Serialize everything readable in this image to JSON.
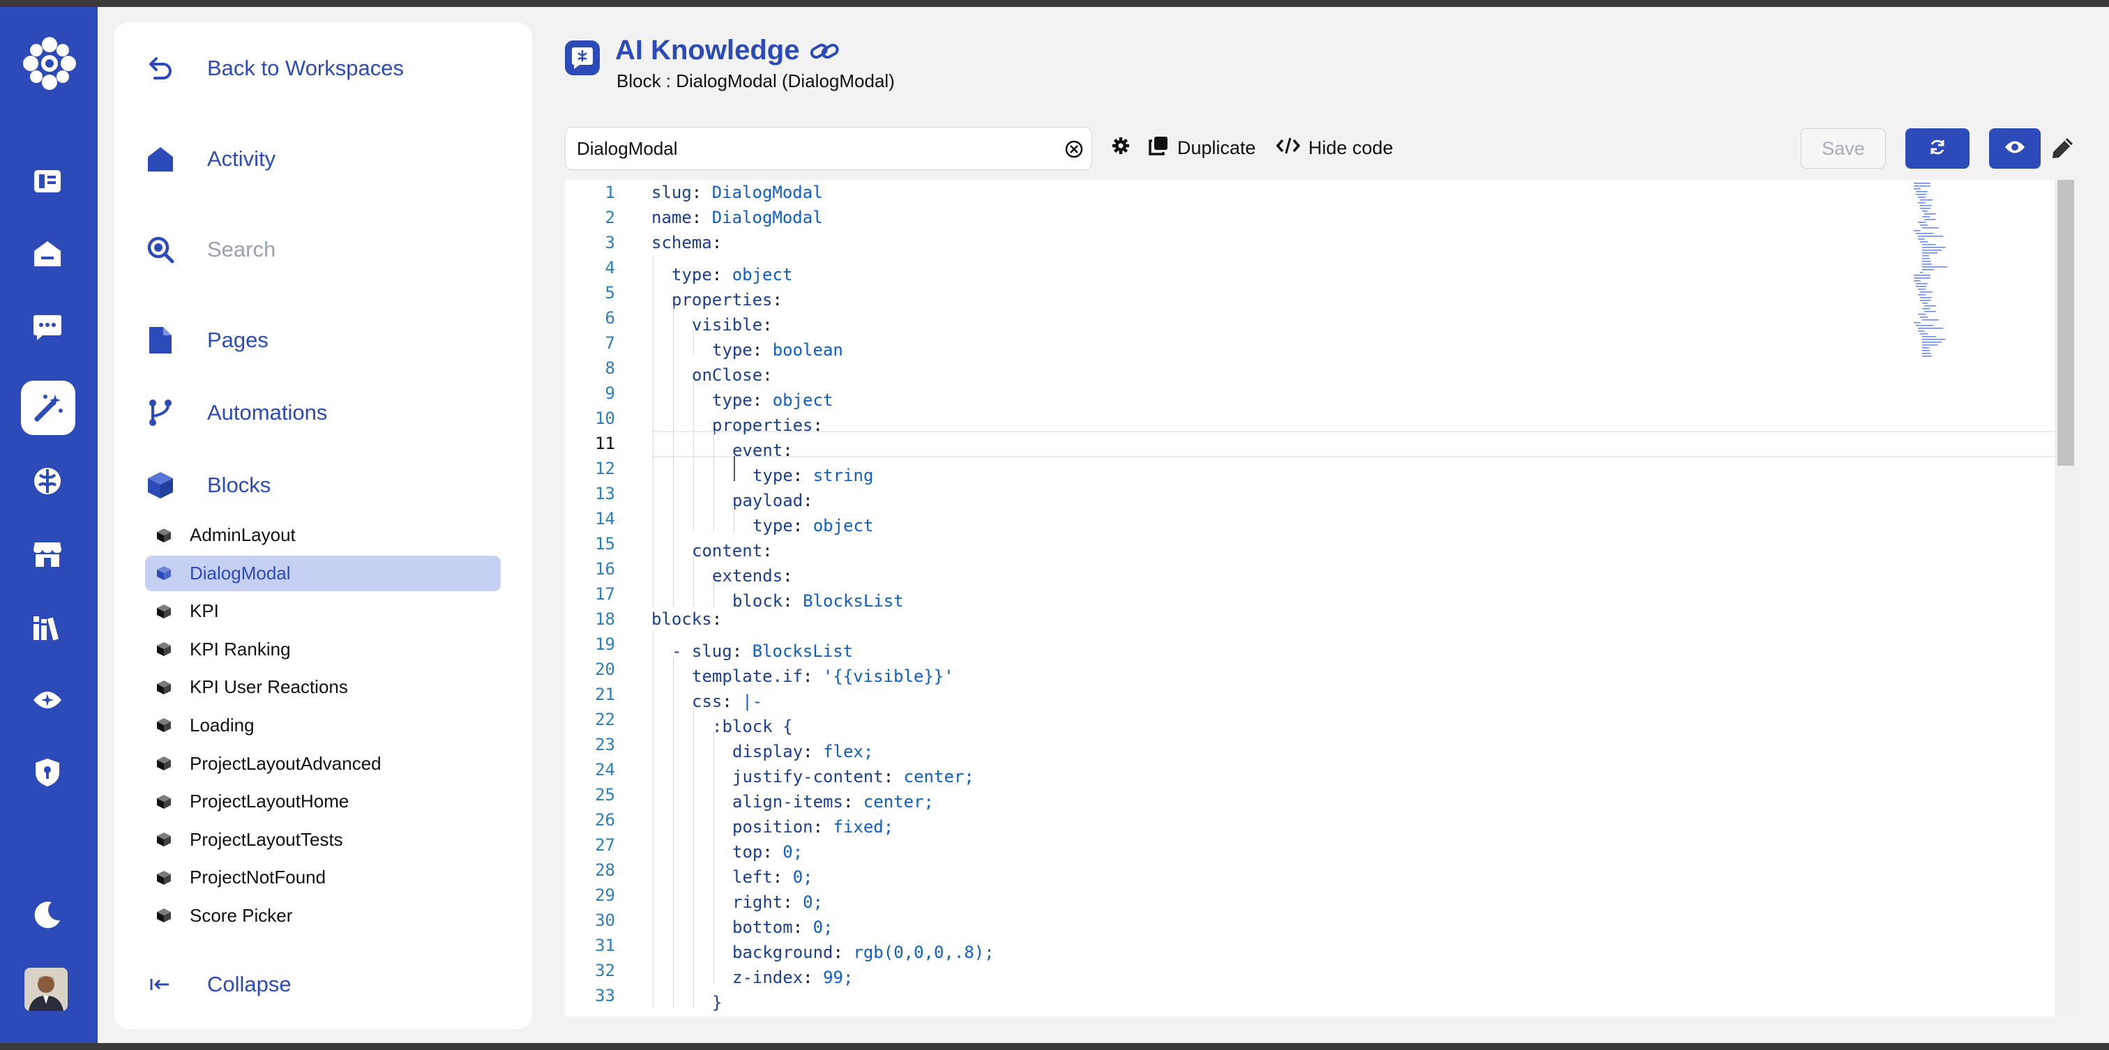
{
  "app": {
    "title": "AI Knowledge",
    "subtitle": "Block : DialogModal (DialogModal)"
  },
  "rail": {
    "icons": [
      "app-logo-icon",
      "dashboard-icon",
      "home-icon",
      "chat-icon",
      "magic-wand-icon",
      "brain-icon",
      "store-icon",
      "library-icon",
      "eye-icon",
      "shield-icon",
      "moon-icon",
      "user-avatar"
    ]
  },
  "nav": {
    "back": "Back to Workspaces",
    "activity": "Activity",
    "search": "Search",
    "pages": "Pages",
    "automations": "Automations",
    "blocks": "Blocks",
    "collapse": "Collapse",
    "block_items": [
      {
        "label": "AdminLayout",
        "active": false
      },
      {
        "label": "DialogModal",
        "active": true
      },
      {
        "label": "KPI",
        "active": false
      },
      {
        "label": "KPI Ranking",
        "active": false
      },
      {
        "label": "KPI User Reactions",
        "active": false
      },
      {
        "label": "Loading",
        "active": false
      },
      {
        "label": "ProjectLayoutAdvanced",
        "active": false
      },
      {
        "label": "ProjectLayoutHome",
        "active": false
      },
      {
        "label": "ProjectLayoutTests",
        "active": false
      },
      {
        "label": "ProjectNotFound",
        "active": false
      },
      {
        "label": "Score Picker",
        "active": false
      }
    ]
  },
  "toolbar": {
    "search_value": "DialogModal",
    "duplicate": "Duplicate",
    "hide_code": "Hide code",
    "save": "Save"
  },
  "editor": {
    "current_line": 11,
    "lines": [
      {
        "n": 1,
        "indent": 0,
        "key": "slug",
        "sep": ": ",
        "val": "DialogModal"
      },
      {
        "n": 2,
        "indent": 0,
        "key": "name",
        "sep": ": ",
        "val": "DialogModal"
      },
      {
        "n": 3,
        "indent": 0,
        "key": "schema",
        "sep": ":",
        "val": ""
      },
      {
        "n": 4,
        "indent": 1,
        "key": "type",
        "sep": ": ",
        "val": "object"
      },
      {
        "n": 5,
        "indent": 1,
        "key": "properties",
        "sep": ":",
        "val": ""
      },
      {
        "n": 6,
        "indent": 2,
        "key": "visible",
        "sep": ":",
        "val": ""
      },
      {
        "n": 7,
        "indent": 3,
        "key": "type",
        "sep": ": ",
        "val": "boolean"
      },
      {
        "n": 8,
        "indent": 2,
        "key": "onClose",
        "sep": ":",
        "val": ""
      },
      {
        "n": 9,
        "indent": 3,
        "key": "type",
        "sep": ": ",
        "val": "object"
      },
      {
        "n": 10,
        "indent": 3,
        "key": "properties",
        "sep": ":",
        "val": ""
      },
      {
        "n": 11,
        "indent": 4,
        "key": "event",
        "sep": ":",
        "val": ""
      },
      {
        "n": 12,
        "indent": 5,
        "key": "type",
        "sep": ": ",
        "val": "string"
      },
      {
        "n": 13,
        "indent": 4,
        "key": "payload",
        "sep": ":",
        "val": ""
      },
      {
        "n": 14,
        "indent": 5,
        "key": "type",
        "sep": ": ",
        "val": "object"
      },
      {
        "n": 15,
        "indent": 2,
        "key": "content",
        "sep": ":",
        "val": ""
      },
      {
        "n": 16,
        "indent": 3,
        "key": "extends",
        "sep": ":",
        "val": ""
      },
      {
        "n": 17,
        "indent": 4,
        "key": "block",
        "sep": ": ",
        "val": "BlocksList"
      },
      {
        "n": 18,
        "indent": 0,
        "key": "blocks",
        "sep": ":",
        "val": ""
      },
      {
        "n": 19,
        "indent": 1,
        "key": "- slug",
        "sep": ": ",
        "val": "BlocksList"
      },
      {
        "n": 20,
        "indent": 2,
        "key": "template.if",
        "sep": ": ",
        "val": "'{{visible}}'"
      },
      {
        "n": 21,
        "indent": 2,
        "key": "css",
        "sep": ": ",
        "val": "|-"
      },
      {
        "n": 22,
        "indent": 3,
        "key": ":block {",
        "sep": "",
        "val": ""
      },
      {
        "n": 23,
        "indent": 4,
        "key": "display",
        "sep": ": ",
        "val": "flex;"
      },
      {
        "n": 24,
        "indent": 4,
        "key": "justify-content",
        "sep": ": ",
        "val": "center;"
      },
      {
        "n": 25,
        "indent": 4,
        "key": "align-items",
        "sep": ": ",
        "val": "center;"
      },
      {
        "n": 26,
        "indent": 4,
        "key": "position",
        "sep": ": ",
        "val": "fixed;"
      },
      {
        "n": 27,
        "indent": 4,
        "key": "top",
        "sep": ": ",
        "val": "0;"
      },
      {
        "n": 28,
        "indent": 4,
        "key": "left",
        "sep": ": ",
        "val": "0;"
      },
      {
        "n": 29,
        "indent": 4,
        "key": "right",
        "sep": ": ",
        "val": "0;"
      },
      {
        "n": 30,
        "indent": 4,
        "key": "bottom",
        "sep": ": ",
        "val": "0;"
      },
      {
        "n": 31,
        "indent": 4,
        "key": "background",
        "sep": ": ",
        "val": "rgb(0,0,0,.8);"
      },
      {
        "n": 32,
        "indent": 4,
        "key": "z-index",
        "sep": ": ",
        "val": "99;"
      },
      {
        "n": 33,
        "indent": 3,
        "key": "}",
        "sep": "",
        "val": ""
      }
    ]
  },
  "colors": {
    "brand": "#2c4bb8",
    "rail_bg": "#2c4bb8",
    "active_block_bg": "#c5d0f3",
    "code_key": "#1a3f8f",
    "code_value": "#0f5ec7"
  }
}
